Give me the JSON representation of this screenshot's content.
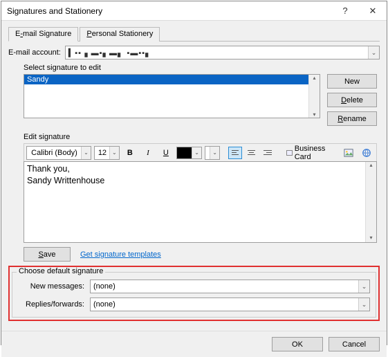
{
  "window": {
    "title": "Signatures and Stationery",
    "help_label": "?",
    "close_label": "✕"
  },
  "tabs": {
    "email_signature": {
      "pre": "E",
      "ul": "-",
      "post": "mail Signature"
    },
    "personal_stationery": {
      "pre": "",
      "ul": "P",
      "post": "ersonal Stationery"
    }
  },
  "email_account": {
    "label_pre": "E-mail ",
    "label_ul": "a",
    "label_post": "ccount:",
    "value": "▍▪▪▗ ▬▪▖▬▖ ▪▬▪▪▖"
  },
  "select_signature": {
    "label_pre": "Sele",
    "label_ul": "c",
    "label_post": "t signature to edit",
    "items": [
      {
        "name": "Sandy",
        "selected": true
      }
    ]
  },
  "side_buttons": {
    "new": "New",
    "delete": "Delete",
    "rename": "Rename"
  },
  "edit": {
    "label_pre": "Edi",
    "label_ul": "t",
    "label_post": " signature",
    "font": "Calibri (Body)",
    "size": "12",
    "bold": "B",
    "italic": "I",
    "underline": "U",
    "bizcard_pre": "",
    "bizcard_ul": "B",
    "bizcard_post": "usiness Card",
    "content_line1": "Thank you,",
    "content_line2": "Sandy Writtenhouse"
  },
  "save": {
    "label": "Save",
    "link": "Get signature templates"
  },
  "defaults": {
    "legend": "Choose default signature",
    "new_pre": "New ",
    "new_ul": "m",
    "new_post": "essages:",
    "new_val": "(none)",
    "rep_pre": "Replies/",
    "rep_ul": "f",
    "rep_post": "orwards:",
    "rep_val": "(none)"
  },
  "footer": {
    "ok": "OK",
    "cancel": "Cancel"
  }
}
